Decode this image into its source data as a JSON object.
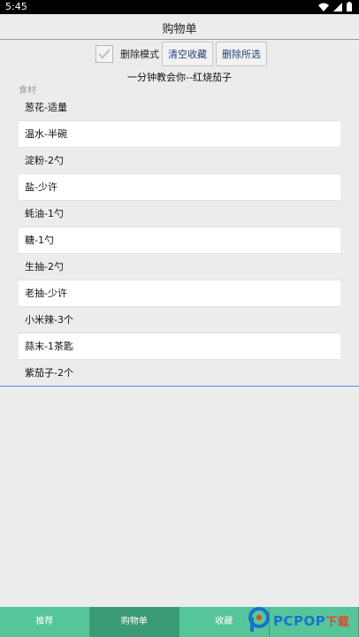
{
  "status_bar": {
    "time": "5:45"
  },
  "header": {
    "title": "购物单"
  },
  "toolbar": {
    "delete_mode_label": "删除模式",
    "clear_favorites_label": "清空收藏",
    "delete_selected_label": "删除所选",
    "delete_mode_checked": true
  },
  "recipe": {
    "title": "一分钟教会你--红烧茄子"
  },
  "ingredients": {
    "section_label": "食材",
    "items": [
      "葱花-适量",
      "温水-半碗",
      "淀粉-2勺",
      "盐-少许",
      "蚝油-1勺",
      "糖-1勺",
      "生抽-2勺",
      "老抽-少许",
      "小米辣-3个",
      "蒜末-1茶匙",
      "紫茄子-2个"
    ]
  },
  "bottom_nav": {
    "tabs": [
      "推荐",
      "购物单",
      "收藏"
    ],
    "active_index": 1
  },
  "watermark": {
    "brand": "PCPOP",
    "suffix": "下载"
  },
  "colors": {
    "nav_green": "#56c59a",
    "nav_active": "#3a9a76",
    "button_text": "#27407a",
    "divider_blue": "#4a90e2",
    "watermark_blue": "#1a73c8",
    "watermark_red": "#e7432b"
  },
  "icons": {
    "status": [
      "wifi-icon",
      "signal-icon",
      "battery-icon"
    ],
    "checkbox": "checkmark-icon",
    "watermark": "pcpop-logo-icon"
  }
}
